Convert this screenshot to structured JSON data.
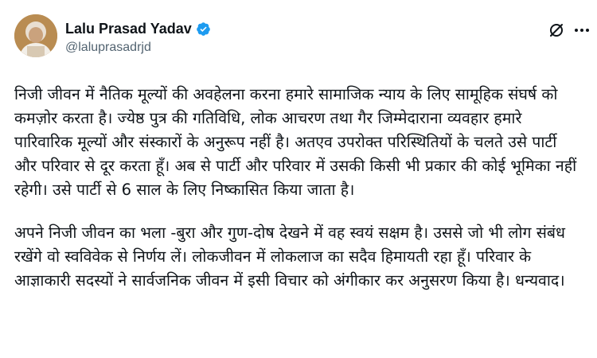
{
  "author": {
    "display_name": "Lalu Prasad Yadav",
    "handle": "@laluprasadrjd",
    "verified": true,
    "verified_color": "#1d9bf0"
  },
  "icons": {
    "verified": "verified-badge-icon",
    "grok": "grok-icon",
    "more": "more-options-icon"
  },
  "post": {
    "paragraphs": [
      "निजी जीवन में नैतिक मूल्यों की अवहेलना करना हमारे सामाजिक न्याय के लिए सामूहिक संघर्ष को कमज़ोर करता है। ज्येष्ठ पुत्र की गतिविधि, लोक आचरण तथा गैर जिम्मेदाराना व्यवहार हमारे पारिवारिक मूल्यों और संस्कारों के अनुरूप नहीं है। अतएव उपरोक्त परिस्थितियों के चलते उसे पार्टी और परिवार से दूर करता हूँ। अब से पार्टी और परिवार में उसकी किसी भी प्रकार की कोई भूमिका नहीं रहेगी। उसे पार्टी से 6 साल के लिए निष्कासित किया जाता है।",
      "अपने निजी जीवन का भला -बुरा और गुण-दोष देखने में वह स्वयं सक्षम है। उससे जो भी लोग संबंध रखेंगे वो स्वविवेक से निर्णय लें। लोकजीवन में लोकलाज का सदैव हिमायती रहा हूँ। परिवार के आज्ञाकारी सदस्यों ने सार्वजनिक जीवन में इसी विचार को अंगीकार कर अनुसरण किया है। धन्यवाद।"
    ]
  }
}
